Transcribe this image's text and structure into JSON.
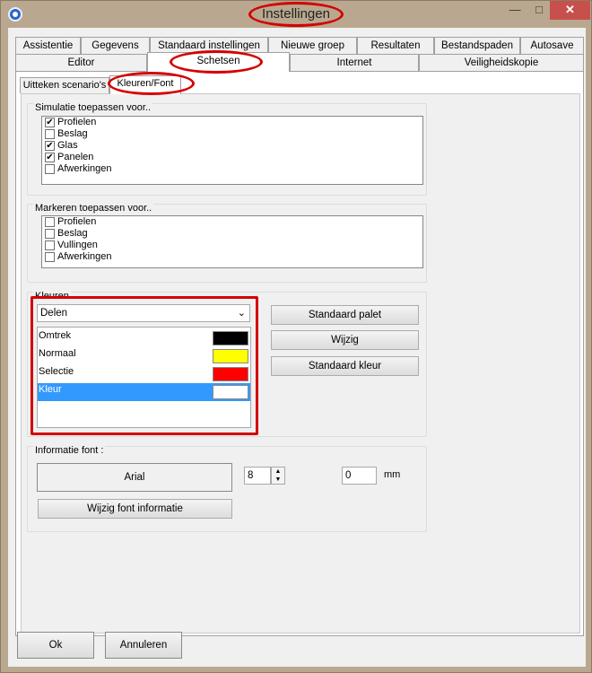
{
  "window": {
    "title": "Instellingen",
    "close_glyph": "✕",
    "min_glyph": "—",
    "max_glyph": "□"
  },
  "tabs_row1": [
    "Assistentie",
    "Gegevens",
    "Standaard instellingen",
    "Nieuwe groep",
    "Resultaten",
    "Bestandspaden",
    "Autosave"
  ],
  "tabs_row2": [
    "Editor",
    "Schetsen",
    "Internet",
    "Veiligheidskopie"
  ],
  "active_tab": "Schetsen",
  "subtabs": [
    "Uitteken scenario's",
    "Kleuren/Font"
  ],
  "active_subtab": "Kleuren/Font",
  "simulatie": {
    "title": "Simulatie toepassen voor..",
    "items": [
      {
        "label": "Profielen",
        "checked": true,
        "mark": "✔"
      },
      {
        "label": "Beslag",
        "checked": false,
        "mark": ""
      },
      {
        "label": "Glas",
        "checked": true,
        "mark": "✔"
      },
      {
        "label": "Panelen",
        "checked": true,
        "mark": "✔"
      },
      {
        "label": "Afwerkingen",
        "checked": false,
        "mark": ""
      }
    ]
  },
  "markeren": {
    "title": "Markeren toepassen voor..",
    "items": [
      {
        "label": "Profielen",
        "checked": false,
        "mark": ""
      },
      {
        "label": "Beslag",
        "checked": false,
        "mark": ""
      },
      {
        "label": "Vullingen",
        "checked": false,
        "mark": ""
      },
      {
        "label": "Afwerkingen",
        "checked": false,
        "mark": ""
      }
    ]
  },
  "kleuren": {
    "title": "Kleuren",
    "combo_value": "Delen",
    "colors": [
      {
        "label": "Omtrek",
        "color": "#000000"
      },
      {
        "label": "Normaal",
        "color": "#ffff00"
      },
      {
        "label": "Selectie",
        "color": "#ff0000"
      },
      {
        "label": "Kleur",
        "color": "#ffffff",
        "selected": true
      }
    ],
    "buttons": [
      "Standaard palet",
      "Wijzig",
      "Standaard kleur"
    ]
  },
  "font": {
    "title": "Informatie font :",
    "preview": "Arial",
    "size": "8",
    "offset": "0",
    "unit": "mm",
    "change_button": "Wijzig font informatie"
  },
  "footer": {
    "ok": "Ok",
    "cancel": "Annuleren"
  },
  "accent": {
    "highlight": "#d40000",
    "selection": "#3399ff"
  }
}
